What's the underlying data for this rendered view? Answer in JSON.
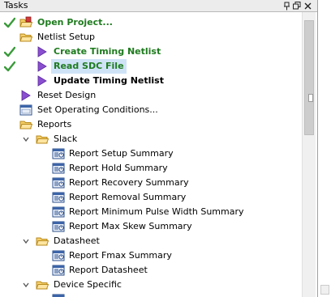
{
  "panel": {
    "title": "Tasks",
    "pin_icon": "pin-icon",
    "float_icon": "float-window-icon",
    "close_icon": "close-icon"
  },
  "tree": {
    "open_project": "Open Project...",
    "netlist_setup": "Netlist Setup",
    "create_timing_netlist": "Create Timing Netlist",
    "read_sdc_file": "Read SDC File",
    "update_timing_netlist": "Update Timing Netlist",
    "reset_design": "Reset Design",
    "set_operating_conditions": "Set Operating Conditions...",
    "reports": "Reports",
    "slack": "Slack",
    "slack_items": [
      "Report Setup Summary",
      "Report Hold Summary",
      "Report Recovery Summary",
      "Report Removal Summary",
      "Report Minimum Pulse Width Summary",
      "Report Max Skew Summary"
    ],
    "datasheet": "Datasheet",
    "datasheet_items": [
      "Report Fmax Summary",
      "Report Datasheet"
    ],
    "device_specific": "Device Specific"
  },
  "colors": {
    "completed_text": "#1e7b1e",
    "selection": "#cfe3f7",
    "check": "#3a9a3a",
    "run_arrow": "#7b3fbf",
    "folder": "#e8b64a"
  }
}
